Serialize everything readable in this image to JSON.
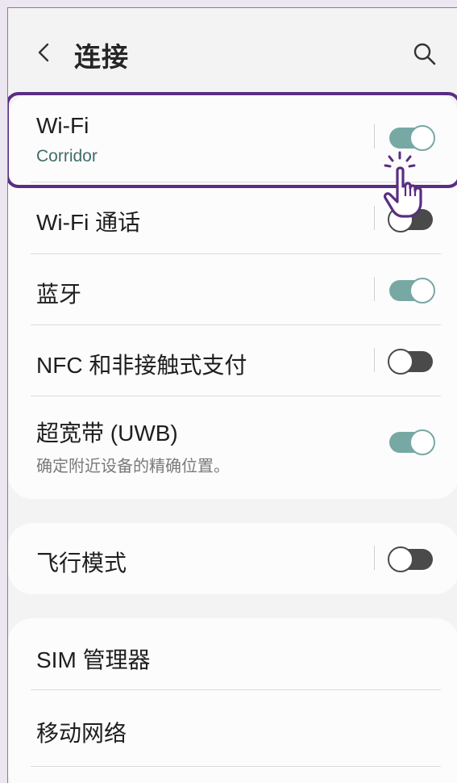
{
  "header": {
    "title": "连接",
    "back_icon": "chevron-left-icon",
    "search_icon": "search-icon"
  },
  "card1": {
    "items": [
      {
        "label": "Wi-Fi",
        "sub": "Corridor",
        "toggle": true
      },
      {
        "label": "Wi-Fi 通话",
        "toggle": false
      },
      {
        "label": "蓝牙",
        "toggle": true
      },
      {
        "label": "NFC 和非接触式支付",
        "toggle": false
      },
      {
        "label": "超宽带 (UWB)",
        "sub": "确定附近设备的精确位置。",
        "toggle": true
      }
    ]
  },
  "card2": {
    "items": [
      {
        "label": "飞行模式",
        "toggle": false
      }
    ]
  },
  "card3": {
    "items": [
      {
        "label": "SIM 管理器"
      },
      {
        "label": "移动网络"
      }
    ]
  },
  "colors": {
    "accent_toggle_on": "#77a8a4",
    "toggle_off": "#4a4a4a",
    "highlight_border": "#5a2d82",
    "wifi_subtitle": "#3e6e6b",
    "secondary_text": "#7a7a7a"
  },
  "overlay": {
    "pointer_icon": "hand-pointer-click-icon"
  }
}
